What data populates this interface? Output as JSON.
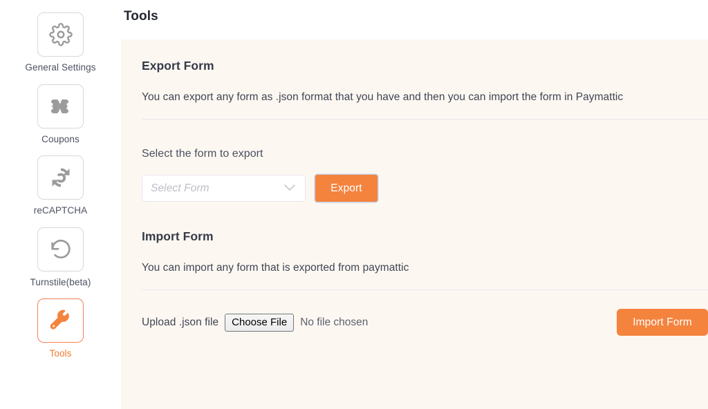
{
  "page": {
    "title": "Tools",
    "accent_color": "#f4833e",
    "panel_bg": "#fdf7f2"
  },
  "sidebar": {
    "items": [
      {
        "label": "General Settings",
        "icon": "gear-icon",
        "active": false
      },
      {
        "label": "Coupons",
        "icon": "coupon-icon",
        "active": false
      },
      {
        "label": "reCAPTCHA",
        "icon": "recaptcha-icon",
        "active": false
      },
      {
        "label": "Turnstile(beta)",
        "icon": "turnstile-icon",
        "active": false
      },
      {
        "label": "Tools",
        "icon": "wrench-icon",
        "active": true
      }
    ]
  },
  "export_section": {
    "title": "Export Form",
    "description": "You can export any form as .json format that you have and then you can import the form in Paymattic",
    "select_label": "Select the form to export",
    "select_placeholder": "Select Form",
    "select_value": "",
    "export_button": "Export"
  },
  "import_section": {
    "title": "Import Form",
    "description": "You can import any form that is exported from paymattic",
    "upload_label": "Upload .json file",
    "choose_file_button": "Choose File",
    "no_file_text": "No file chosen",
    "import_button": "Import Form"
  }
}
